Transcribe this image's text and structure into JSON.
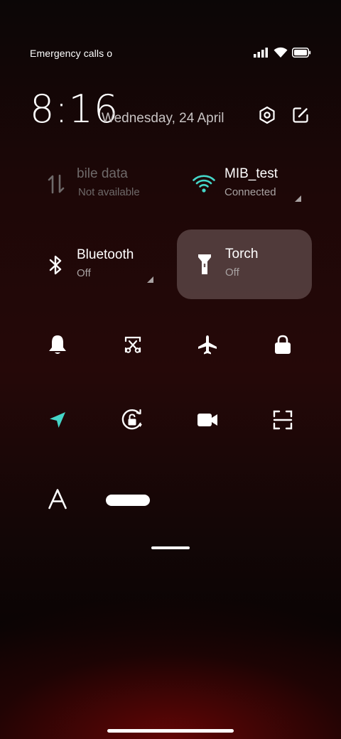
{
  "status_bar": {
    "carrier_text": "Emergency calls o",
    "icons": [
      "signal-icon",
      "wifi-icon",
      "battery-icon"
    ]
  },
  "header": {
    "time": "8:16",
    "date": "Wednesday, 24 April",
    "buttons": [
      "settings-icon",
      "edit-icon"
    ]
  },
  "tiles": [
    {
      "name": "bile data",
      "status": "Not available",
      "icon": "mobile-data-icon",
      "state": "unavailable"
    },
    {
      "name": "MIB_test",
      "status": "Connected",
      "icon": "wifi-icon",
      "state": "on"
    },
    {
      "name": "Bluetooth",
      "status": "Off",
      "icon": "bluetooth-icon",
      "state": "off"
    },
    {
      "name": "Torch",
      "status": "Off",
      "icon": "torch-icon",
      "state": "highlighted"
    }
  ],
  "quick_toggles": [
    [
      "bell-icon",
      "screenshot-icon",
      "airplane-icon",
      "lock-icon"
    ],
    [
      "location-icon",
      "auto-rotate-icon",
      "video-icon",
      "scanner-icon"
    ],
    [
      "font-size-icon",
      "brightness-slider"
    ]
  ],
  "colors": {
    "accent": "#45d6c8",
    "text_secondary": "#a8a2a2",
    "tile_active_bg": "#6b5858"
  }
}
